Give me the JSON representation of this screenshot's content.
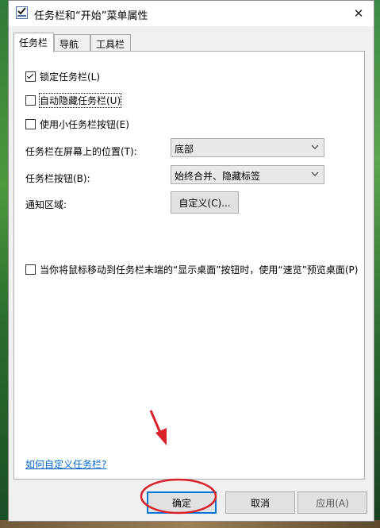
{
  "window": {
    "title": "任务栏和“开始”菜单属性"
  },
  "tabs": [
    {
      "label": "任务栏"
    },
    {
      "label": "导航"
    },
    {
      "label": "工具栏"
    }
  ],
  "checkboxes": {
    "lock": {
      "label": "锁定任务栏(L)",
      "checked": true
    },
    "autohide": {
      "label": "自动隐藏任务栏(U)",
      "checked": false
    },
    "small": {
      "label": "使用小任务栏按钮(E)",
      "checked": false
    },
    "peek": {
      "label": "当你将鼠标移动到任务栏末端的“显示桌面”按钮时，使用“速览”预览桌面(P)",
      "checked": false
    }
  },
  "fields": {
    "location_label": "任务栏在屏幕上的位置(T):",
    "location_value": "底部",
    "buttons_label": "任务栏按钮(B):",
    "buttons_value": "始终合并、隐藏标签",
    "notify_label": "通知区域:",
    "customize_button": "自定义(C)..."
  },
  "help_link": "如何自定义任务栏?",
  "footer": {
    "ok": "确定",
    "cancel": "取消",
    "apply": "应用(A)"
  },
  "annotation_color": "#d9232c"
}
